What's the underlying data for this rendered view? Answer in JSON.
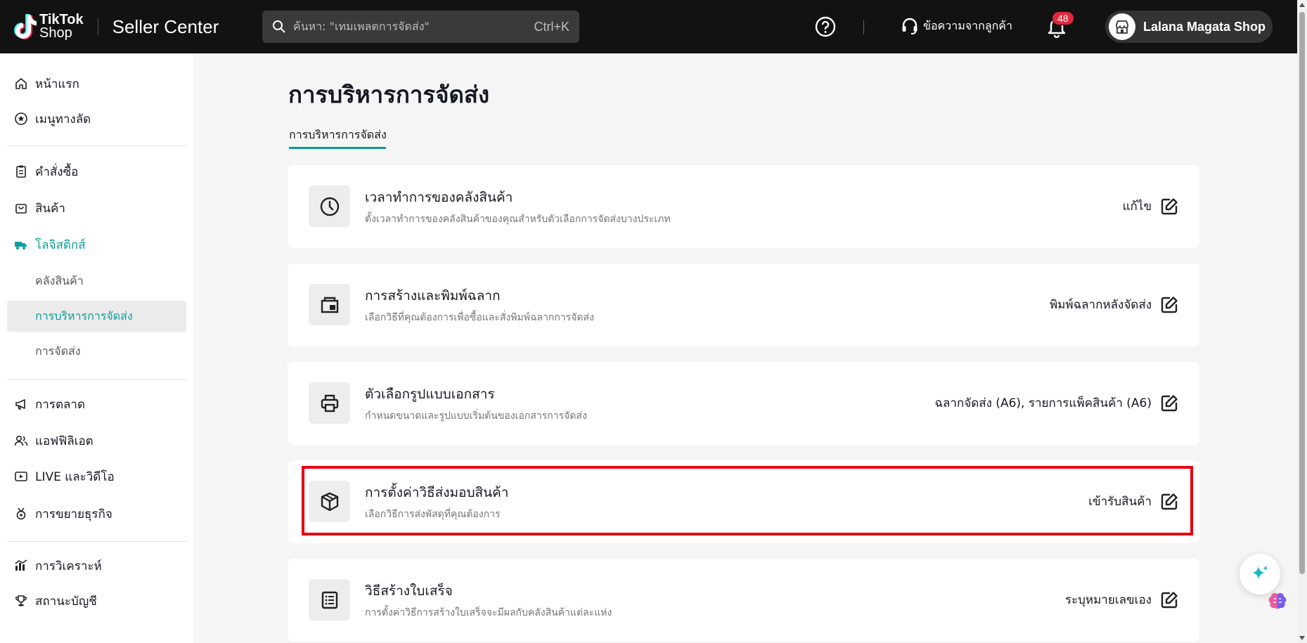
{
  "header": {
    "logo_line1": "TikTok",
    "logo_line2": "Shop",
    "app_name": "Seller Center",
    "search_placeholder": "ค้นหา: \"เทมเพลตการจัดส่ง\"",
    "search_shortcut": "Ctrl+K",
    "customer_messages": "ข้อความจากลูกค้า",
    "notification_count": "48",
    "shop_name": "Lalana Magata Shop"
  },
  "sidebar": {
    "home": "หน้าแรก",
    "shortcuts": "เมนูทางลัด",
    "orders": "คำสั่งซื้อ",
    "products": "สินค้า",
    "logistics": "โลจิสติกส์",
    "warehouse": "คลังสินค้า",
    "shipping_management": "การบริหารการจัดส่ง",
    "shipping": "การจัดส่ง",
    "marketing": "การตลาด",
    "affiliate": "แอฟฟิลิเอต",
    "live_video": "LIVE และวิดีโอ",
    "business_growth": "การขยายธุรกิจ",
    "analytics": "การวิเคราะห์",
    "account_status": "สถานะบัญชี"
  },
  "main": {
    "title": "การบริหารการจัดส่ง",
    "tab": "การบริหารการจัดส่ง",
    "cards": [
      {
        "title": "เวลาทำการของคลังสินค้า",
        "desc": "ตั้งเวลาทำการของคลังสินค้าของคุณสำหรับตัวเลือกการจัดส่งบางประเภท",
        "action": "แก้ไข",
        "icon": "clock-icon"
      },
      {
        "title": "การสร้างและพิมพ์ฉลาก",
        "desc": "เลือกวิธีที่คุณต้องการเพื่อซื้อและสั่งพิมพ์ฉลากการจัดส่ง",
        "action": "พิมพ์ฉลากหลังจัดส่ง",
        "icon": "label-print-icon"
      },
      {
        "title": "ตัวเลือกรูปแบบเอกสาร",
        "desc": "กำหนดขนาดและรูปแบบเริ่มต้นของเอกสารการจัดส่ง",
        "action": "ฉลากจัดส่ง (A6), รายการแพ็คสินค้า (A6)",
        "icon": "printer-icon"
      },
      {
        "title": "การตั้งค่าวิธีส่งมอบสินค้า",
        "desc": "เลือกวิธีการส่งพัสดุที่คุณต้องการ",
        "action": "เข้ารับสินค้า",
        "icon": "package-icon"
      },
      {
        "title": "วิธีสร้างใบเสร็จ",
        "desc": "การตั้งค่าวิธีการสร้างใบเสร็จจะมีผลกับคลังสินค้าแต่ละแห่ง",
        "action": "ระบุหมายเลขเอง",
        "icon": "list-icon"
      }
    ]
  }
}
